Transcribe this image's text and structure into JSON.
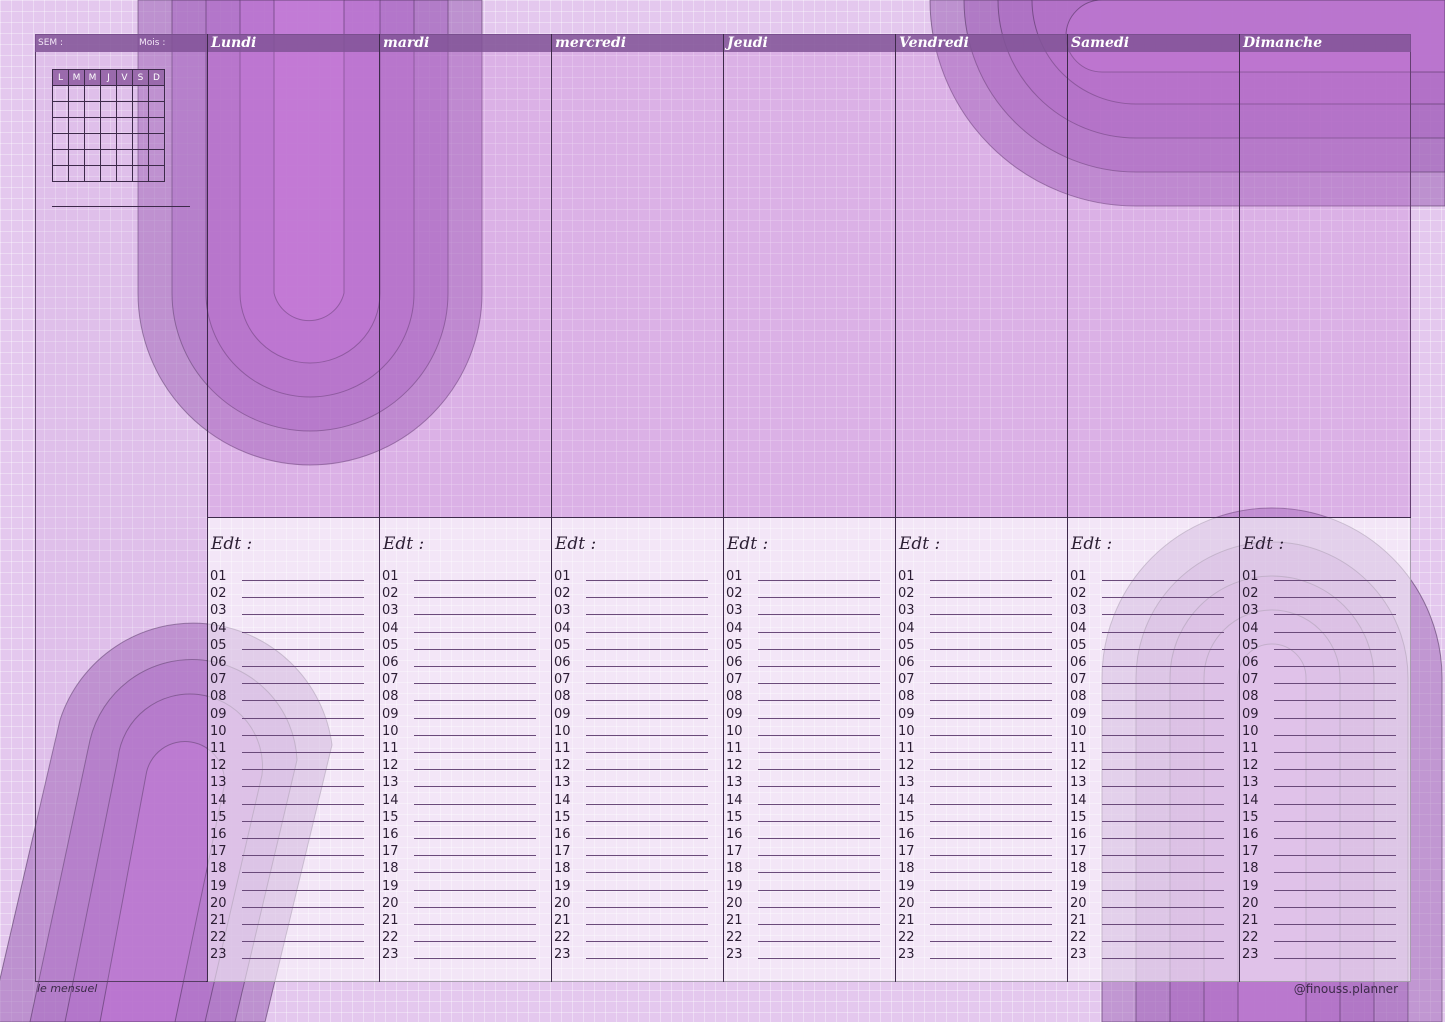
{
  "header": {
    "sem_label": "SEM :",
    "mois_label": "Mois :"
  },
  "mini_calendar": {
    "weekdays": [
      "L",
      "M",
      "M",
      "J",
      "V",
      "S",
      "D"
    ],
    "rows": 6
  },
  "days": [
    {
      "name": "Lundi",
      "edt_label": "Edt :"
    },
    {
      "name": "mardi",
      "edt_label": "Edt :"
    },
    {
      "name": "mercredi",
      "edt_label": "Edt :"
    },
    {
      "name": "Jeudi",
      "edt_label": "Edt :"
    },
    {
      "name": "Vendredi",
      "edt_label": "Edt :"
    },
    {
      "name": "Samedi",
      "edt_label": "Edt :"
    },
    {
      "name": "Dimanche",
      "edt_label": "Edt :"
    }
  ],
  "hours": [
    "01",
    "02",
    "03",
    "04",
    "05",
    "06",
    "07",
    "08",
    "09",
    "10",
    "11",
    "12",
    "13",
    "14",
    "15",
    "16",
    "17",
    "18",
    "19",
    "20",
    "21",
    "22",
    "23"
  ],
  "footer": {
    "left": "le mensuel",
    "right": "@finouss.planner"
  },
  "colors": {
    "background": "#e4c8ee",
    "header_bar": "#835498",
    "line": "#3d2a4a"
  }
}
